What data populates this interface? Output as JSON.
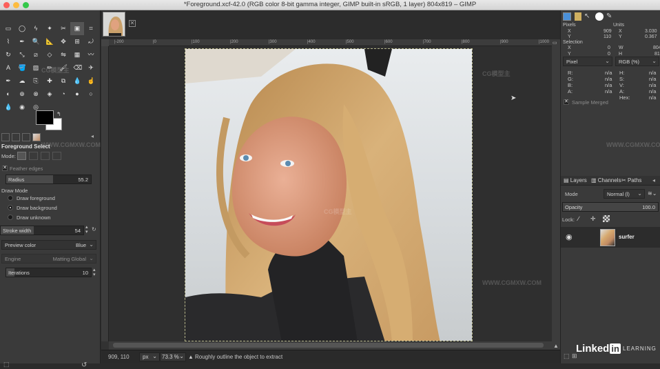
{
  "window": {
    "title": "*Foreground.xcf-42.0 (RGB color 8-bit gamma integer, GIMP built-in sRGB, 1 layer) 804x819 – GIMP"
  },
  "toolbox": {
    "icons": [
      "rect-select-icon",
      "ellipse-select-icon",
      "free-select-icon",
      "fuzzy-select-icon",
      "scissors-icon",
      "foreground-select-icon",
      "crop-icon",
      "paths-icon",
      "color-picker-icon",
      "zoom-icon",
      "measure-icon",
      "move-icon",
      "align-icon",
      "transform-icon",
      "rotate-icon",
      "scale-icon",
      "shear-icon",
      "perspective-icon",
      "flip-icon",
      "cage-icon",
      "warp-icon",
      "text-icon",
      "bucket-fill-icon",
      "blend-icon",
      "pencil-icon",
      "paintbrush-icon",
      "eraser-icon",
      "airbrush-icon",
      "ink-icon",
      "mypaint-icon",
      "clone-icon",
      "heal-icon",
      "perspective-clone-icon",
      "blur-icon",
      "smudge-icon",
      "dodge-icon",
      "unified-transform-icon",
      "handle-transform-icon",
      "gegl-icon",
      "sample-icon",
      "foreground-icon",
      "background-icon",
      "drop-icon",
      "blob-icon",
      "spiral-icon"
    ]
  },
  "tool_options": {
    "title": "Foreground Select",
    "mode_label": "Mode:",
    "feather_label": "Feather edges",
    "radius_label": "Radius",
    "radius_value": "55.2",
    "draw_mode_label": "Draw Mode",
    "draw_options": [
      "Draw foreground",
      "Draw background",
      "Draw unknown"
    ],
    "selected_draw_option": 1,
    "stroke_label": "Stroke width",
    "stroke_value": "54",
    "preview_label": "Preview color",
    "preview_value": "Blue",
    "engine_label": "Engine",
    "engine_value": "Matting Global",
    "iterations_label": "Iterations",
    "iterations_value": "10"
  },
  "ruler": {
    "ticks": [
      "|-200",
      "|0",
      "|100",
      "|200",
      "|300",
      "|400",
      "|500",
      "|600",
      "|700",
      "|800",
      "|900",
      "|1000"
    ]
  },
  "status": {
    "coords": "909, 110",
    "unit": "px",
    "zoom": "73.3 %",
    "message": "Roughly outline the object to extract"
  },
  "pointer": {
    "pixels_label": "Pixels",
    "units_label": "Units",
    "x_label": "X",
    "x_val": "909",
    "y_label": "Y",
    "y_val": "110",
    "ux_val": "3.030",
    "uy_val": "0.367",
    "selection_label": "Selection",
    "sx": "0",
    "sy": "0",
    "sw": "804",
    "sh": "81",
    "mode_left": "Pixel",
    "mode_right": "RGB (%)",
    "channels": [
      "R:",
      "G:",
      "B:",
      "A:"
    ],
    "na": "n/a",
    "channels2": [
      "H:",
      "S:",
      "V:",
      "A:",
      "Hex:"
    ],
    "sample_merged": "Sample Merged"
  },
  "layers": {
    "tabs": [
      "Layers",
      "Channels",
      "Paths"
    ],
    "mode_label": "Mode",
    "mode_value": "Normal (l)",
    "opacity_label": "Opacity",
    "opacity_value": "100.0",
    "lock_label": "Lock:",
    "layer_name": "surfer"
  },
  "branding": {
    "linkedin": "Linked",
    "in": "in",
    "learning": "LEARNING",
    "watermark_text": "CG模型主",
    "watermark_url": "WWW.CGMXW.COM"
  },
  "colors": {
    "foreground": "#000000",
    "background": "#ffffff",
    "accent": "#4a90d9"
  }
}
